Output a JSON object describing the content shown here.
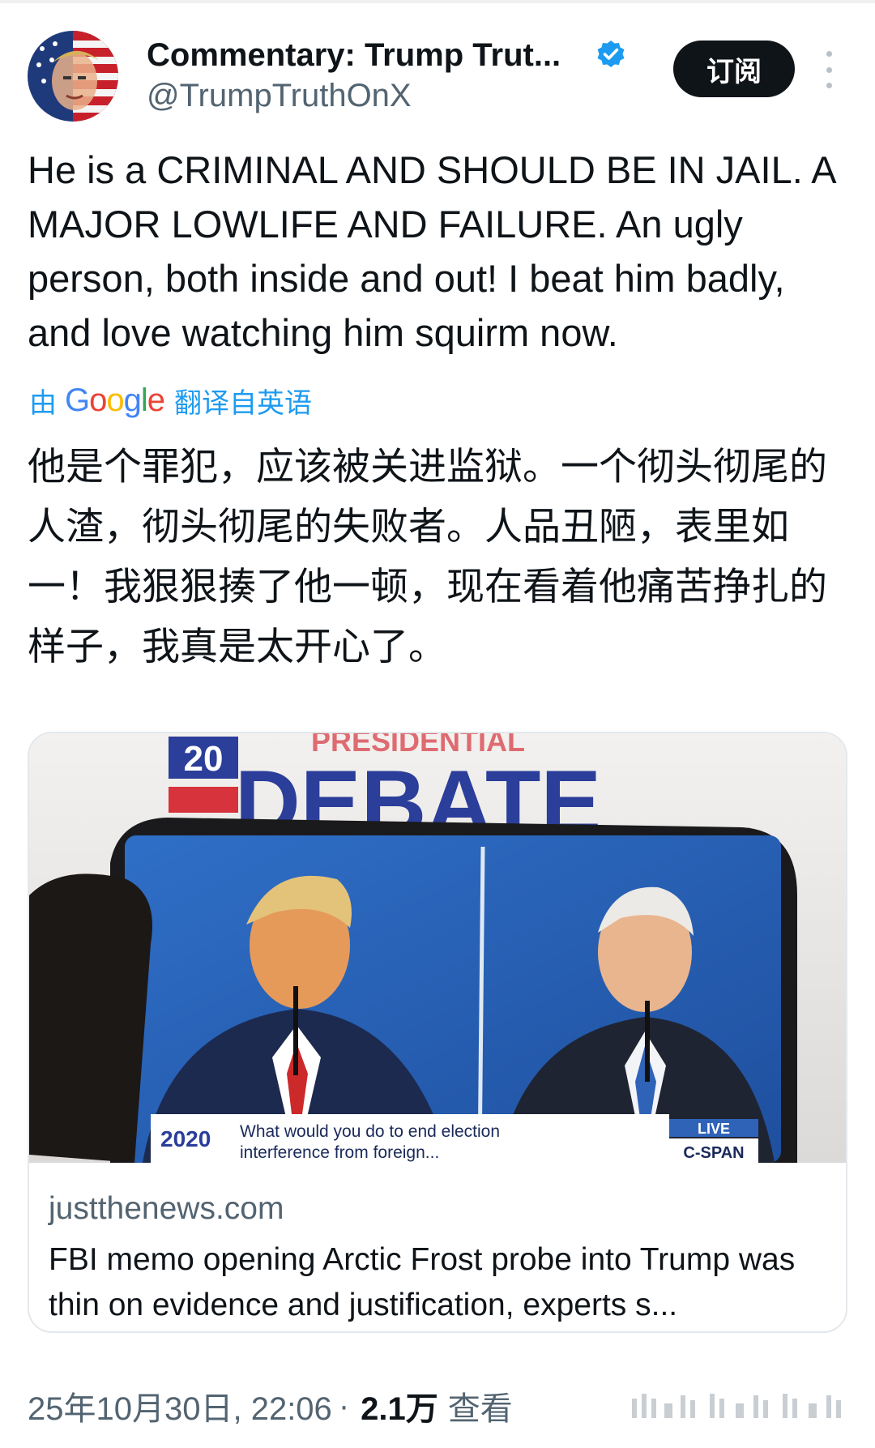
{
  "account": {
    "display_name": "Commentary: Trump Trut...",
    "handle": "@TrumpTruthOnX",
    "verified_icon": "verified-badge-icon",
    "subscribe_label": "订阅",
    "more_icon": "more-vertical-icon"
  },
  "tweet": {
    "text": "He is a CRIMINAL AND SHOULD BE IN JAIL. A MAJOR LOWLIFE AND FAILURE. An ugly person, both inside and out! I beat him badly, and love watching him squirm now.",
    "translation": {
      "prefix": "由",
      "provider": "Google",
      "suffix": "翻译自英语",
      "text": "他是个罪犯，应该被关进监狱。一个彻头彻尾的人渣，彻头彻尾的失败者。人品丑陋，表里如一！我狠狠揍了他一顿，现在看着他痛苦挣扎的样子，我真是太开心了。"
    }
  },
  "link_card": {
    "image_text": {
      "banner_year": "20",
      "banner_top": "PRESIDENTIAL",
      "banner_main": "DEBATE",
      "screen_logo": "2020",
      "screen_question_line1": "What would you do to end election",
      "screen_question_line2": "interference from foreign...",
      "live_label": "LIVE",
      "network_label": "C-SPAN"
    },
    "domain": "justthenews.com",
    "title": "FBI memo opening Arctic Frost probe into Trump was thin on evidence and justification, experts s..."
  },
  "meta": {
    "timestamp": "25年10月30日, 22:06",
    "separator": "·",
    "views_count": "2.1万",
    "views_label": "查看"
  },
  "colors": {
    "accent": "#1d9bf0",
    "text_primary": "#0f1419",
    "text_secondary": "#536471",
    "button_bg": "#0f1419"
  }
}
